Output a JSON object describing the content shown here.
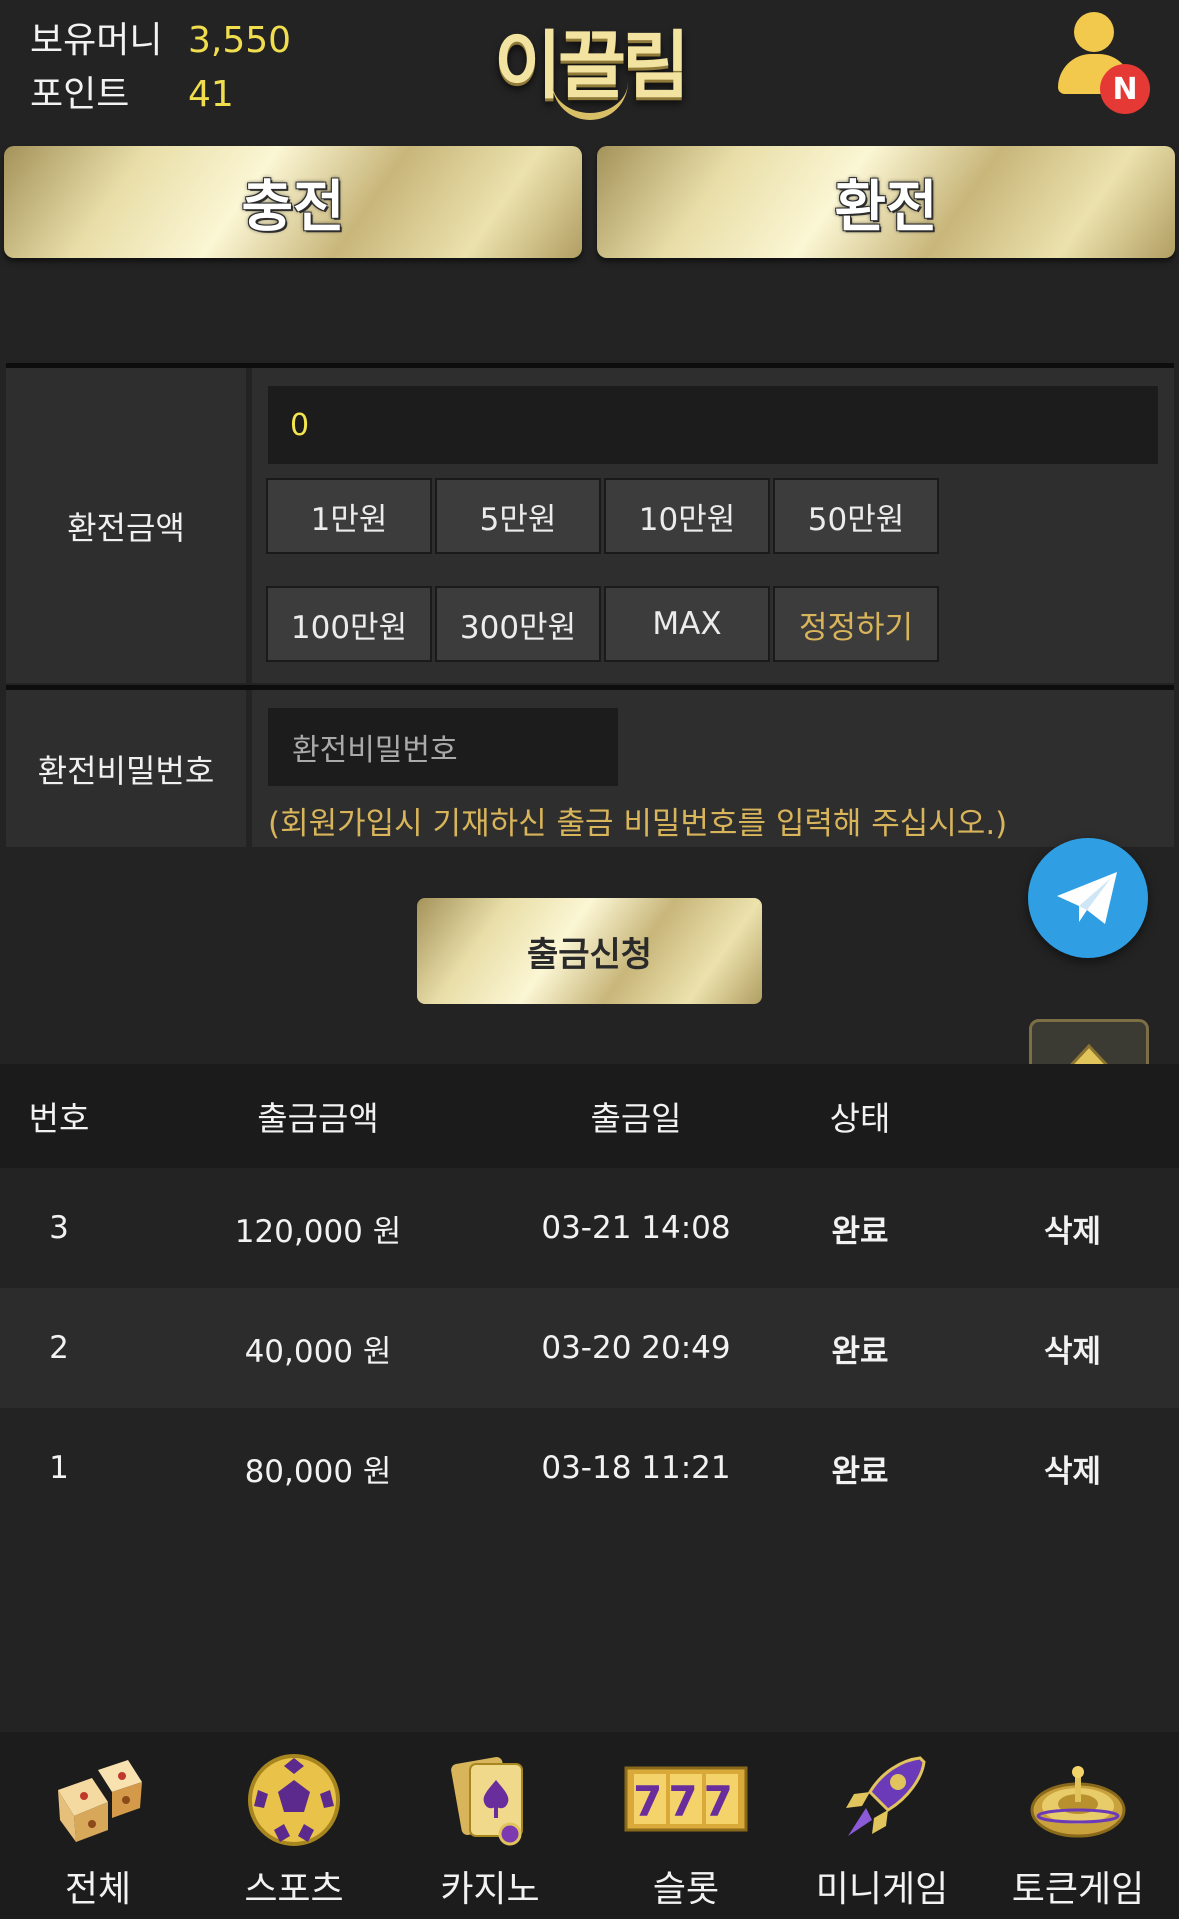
{
  "header": {
    "money_label": "보유머니",
    "money_value": "3,550",
    "points_label": "포인트",
    "points_value": "41",
    "logo_text": "이끌림",
    "notification_badge": "N"
  },
  "top_buttons": {
    "deposit": "충전",
    "withdraw": "환전"
  },
  "form": {
    "amount_label": "환전금액",
    "amount_value": "0",
    "chips": [
      "1만원",
      "5만원",
      "10만원",
      "50만원",
      "100만원",
      "300만원",
      "MAX",
      "정정하기"
    ],
    "password_label": "환전비밀번호",
    "password_placeholder": "환전비밀번호",
    "password_hint": "(회원가입시 기재하신 출금 비밀번호를 입력해 주십시오.)"
  },
  "submit_label": "출금신청",
  "table": {
    "headers": {
      "no": "번호",
      "amount": "출금금액",
      "date": "출금일",
      "state": "상태"
    },
    "rows": [
      {
        "no": "3",
        "amount": "120,000 원",
        "date": "03-21 14:08",
        "state": "완료",
        "action": "삭제"
      },
      {
        "no": "2",
        "amount": "40,000 원",
        "date": "03-20 20:49",
        "state": "완료",
        "action": "삭제"
      },
      {
        "no": "1",
        "amount": "80,000 원",
        "date": "03-18 11:21",
        "state": "완료",
        "action": "삭제"
      }
    ]
  },
  "bottom_nav": [
    {
      "label": "전체",
      "icon": "dice-icon"
    },
    {
      "label": "스포츠",
      "icon": "soccer-ball-icon"
    },
    {
      "label": "카지노",
      "icon": "playing-cards-icon"
    },
    {
      "label": "슬롯",
      "icon": "slot-777-icon",
      "icon_text": "777"
    },
    {
      "label": "미니게임",
      "icon": "rocket-icon"
    },
    {
      "label": "토큰게임",
      "icon": "roulette-icon"
    }
  ],
  "colors": {
    "background": "#232323",
    "gold_text": "#f0de4e",
    "hint_gold": "#d8b45a",
    "telegram_blue": "#2f9ee3",
    "badge_red": "#e53935"
  }
}
